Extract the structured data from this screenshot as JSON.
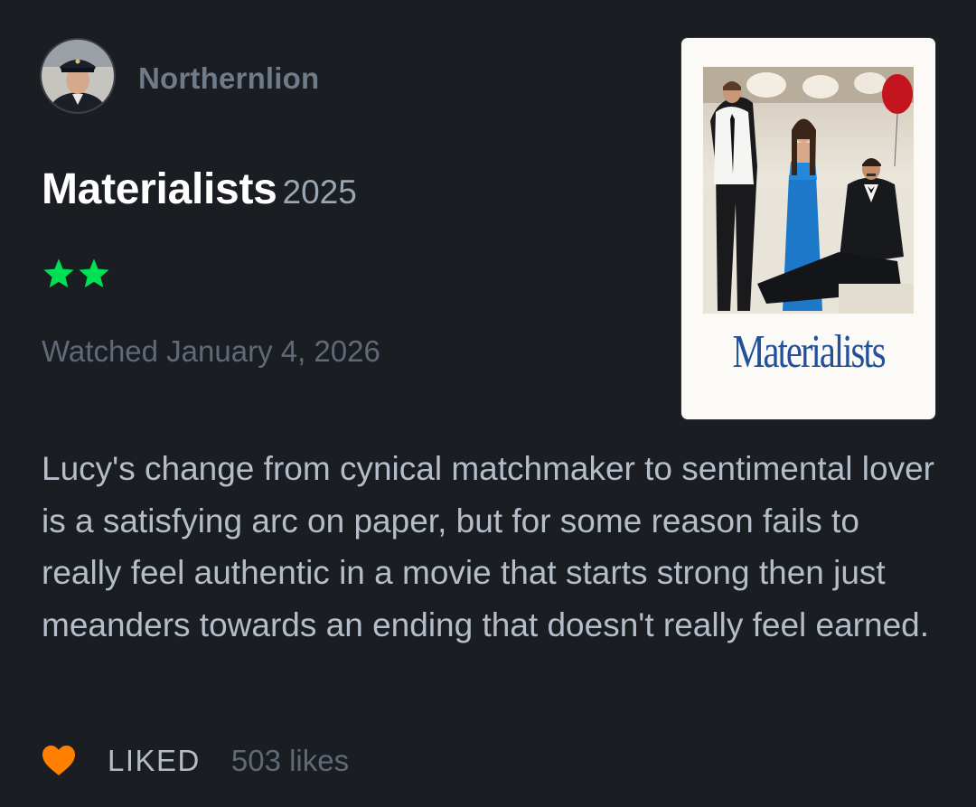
{
  "reviewer": {
    "username": "Northernlion",
    "avatar_icon": "avatar-photo"
  },
  "film": {
    "title": "Materialists",
    "year": "2025",
    "poster_title": "Materialists"
  },
  "rating": {
    "stars": 2,
    "max_stars": 5,
    "star_color": "#00e054"
  },
  "watched": "Watched January 4, 2026",
  "review_text": "Lucy's change from cynical matchmaker to sentimental lover is a satisfying arc on paper, but for some reason fails to really feel authentic in a movie that starts strong then just meanders towards an ending that doesn't really feel earned.",
  "footer": {
    "liked_label": "LIKED",
    "likes_count": "503 likes",
    "heart_color": "#ff8000"
  },
  "colors": {
    "background": "#1a1d21",
    "poster_title": "#23509a"
  }
}
